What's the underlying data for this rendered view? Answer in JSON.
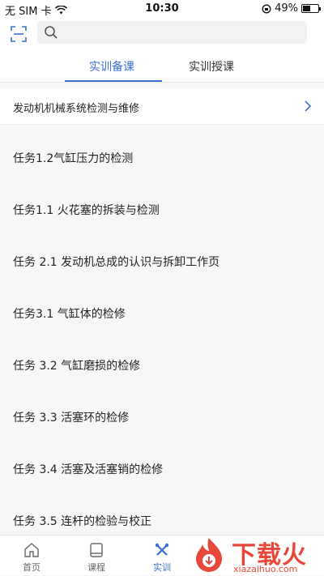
{
  "status_bar": {
    "carrier": "无 SIM 卡",
    "time": "10:30",
    "battery_percent": "49%",
    "battery_level": 0.49
  },
  "search": {
    "placeholder": "",
    "value": ""
  },
  "tabs": [
    {
      "label": "实训备课",
      "active": true
    },
    {
      "label": "实训授课",
      "active": false
    }
  ],
  "course": {
    "title": "发动机机械系统检测与维修"
  },
  "tasks": [
    "任务1.2气缸压力的检测",
    "任务1.1 火花塞的拆装与检测",
    "任务 2.1 发动机总成的认识与拆卸工作页",
    "任务3.1 气缸体的检修",
    "任务 3.2 气缸磨损的检修",
    "任务 3.3 活塞环的检修",
    "任务 3.4 活塞及活塞销的检修",
    "任务 3.5 连杆的检验与校正"
  ],
  "tabbar": {
    "home": "首页",
    "course": "课程",
    "train": "实训"
  },
  "watermark": {
    "title": "下载火",
    "url": "xiazaihuo.com"
  },
  "colors": {
    "accent": "#3c6fd1",
    "watermark": "#e8483a"
  }
}
